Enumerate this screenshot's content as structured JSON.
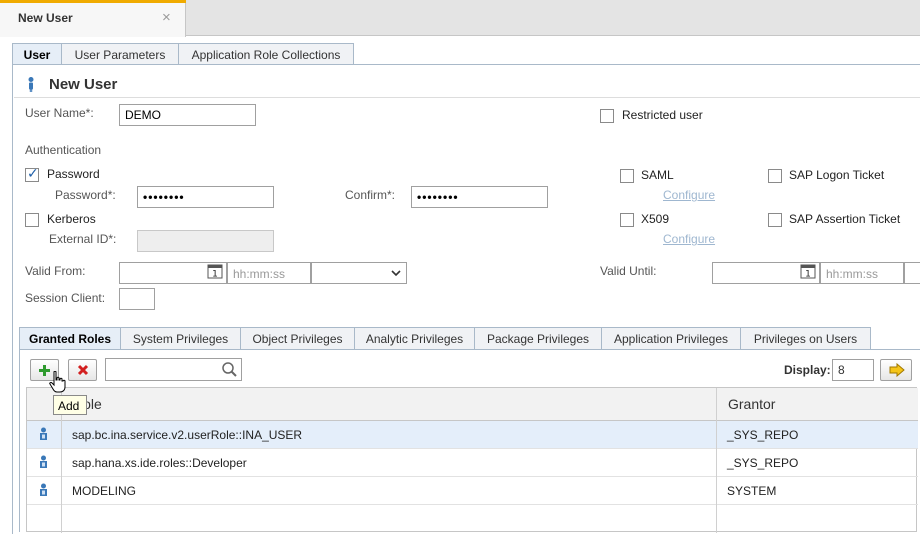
{
  "editor_tab": {
    "title": "New User",
    "close": "×"
  },
  "subtabs": [
    "User",
    "User Parameters",
    "Application Role Collections"
  ],
  "page_title": "New User",
  "form": {
    "user_name_label": "User Name*:",
    "user_name_value": "DEMO",
    "restricted_user_label": "Restricted user",
    "authentication_label": "Authentication",
    "password_label": "Password",
    "password_field_label": "Password*:",
    "password_value": "••••••••",
    "confirm_label": "Confirm*:",
    "confirm_value": "••••••••",
    "kerberos_label": "Kerberos",
    "external_id_label": "External ID*:",
    "saml_label": "SAML",
    "saml_configure": "Configure",
    "x509_label": "X509",
    "x509_configure": "Configure",
    "sap_logon_ticket_label": "SAP Logon Ticket",
    "sap_assertion_ticket_label": "SAP Assertion Ticket",
    "valid_from_label": "Valid From:",
    "valid_until_label": "Valid Until:",
    "time_placeholder": "hh:mm:ss",
    "session_client_label": "Session Client:",
    "calendar_day": "1"
  },
  "privilege_tabs": [
    "Granted Roles",
    "System Privileges",
    "Object Privileges",
    "Analytic Privileges",
    "Package Privileges",
    "Application Privileges",
    "Privileges on Users"
  ],
  "toolbar": {
    "display_label": "Display:",
    "display_value": "8",
    "tooltip": "Add"
  },
  "table": {
    "columns": [
      "Role",
      "Grantor"
    ],
    "rows": [
      {
        "role": "sap.bc.ina.service.v2.userRole::INA_USER",
        "grantor": "_SYS_REPO"
      },
      {
        "role": "sap.hana.xs.ide.roles::Developer",
        "grantor": "_SYS_REPO"
      },
      {
        "role": "MODELING",
        "grantor": "SYSTEM"
      }
    ]
  },
  "colors": {
    "accent": "#f0ab00",
    "tab_border": "#a9b9c9",
    "selected_row": "#e4eefa",
    "add_green": "#2e9a2e",
    "delete_red": "#d21f1f"
  },
  "icons": [
    "user-icon",
    "calendar-icon",
    "chevron-down-icon",
    "add-icon",
    "delete-icon",
    "search-icon",
    "arrow-right-icon",
    "role-icon",
    "hand-cursor-icon"
  ]
}
